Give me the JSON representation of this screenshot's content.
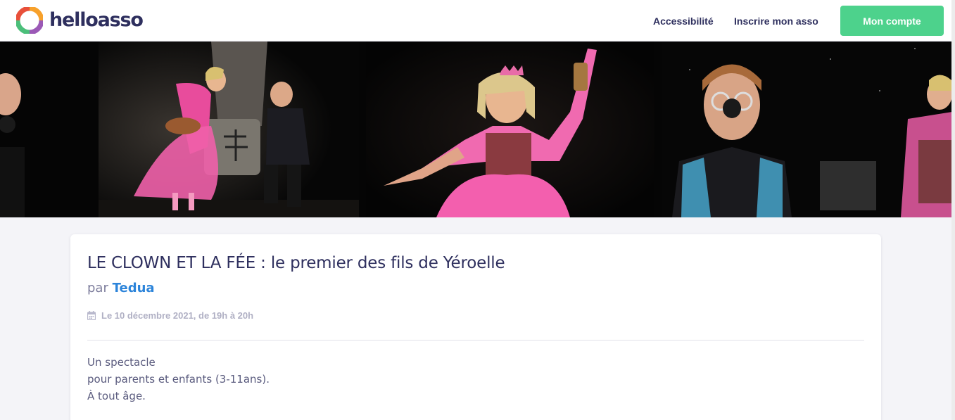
{
  "header": {
    "logo_text": "helloasso",
    "nav": {
      "accessibility": "Accessibilité",
      "register_org": "Inscrire mon asso"
    },
    "account_button": "Mon compte"
  },
  "colors": {
    "brand_dark": "#2e2f5e",
    "account_button": "#4dd28c",
    "link_blue": "#2c84da",
    "page_background": "#f4f4f8"
  },
  "event": {
    "title": "LE CLOWN ET LA FÉE : le premier des fils de Yéroelle",
    "by_prefix": "par",
    "organizer": "Tedua",
    "date": "Le 10 décembre 2021, de 19h à 20h",
    "description": [
      "Un spectacle",
      "pour parents et enfants (3-11ans).",
      "À tout âge."
    ]
  },
  "icons": {
    "logo": "helloasso-logo-icon",
    "date": "calendar-icon"
  }
}
